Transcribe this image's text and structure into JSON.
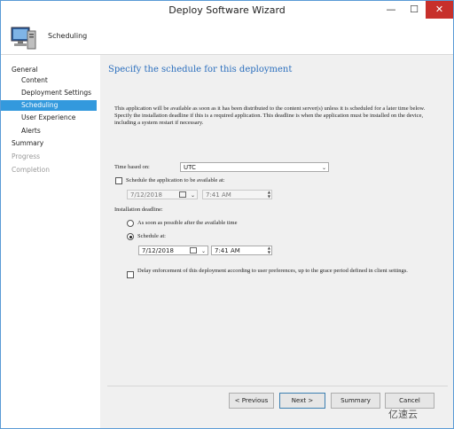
{
  "window": {
    "title": "Deploy Software Wizard",
    "minimize": "—",
    "maximize": "☐",
    "close": "✕"
  },
  "header": {
    "title": "Scheduling",
    "icon": "computer-icon"
  },
  "nav": {
    "items": [
      {
        "label": "General",
        "level": 0,
        "state": "normal"
      },
      {
        "label": "Content",
        "level": 1,
        "state": "normal"
      },
      {
        "label": "Deployment Settings",
        "level": 1,
        "state": "normal"
      },
      {
        "label": "Scheduling",
        "level": 1,
        "state": "selected"
      },
      {
        "label": "User Experience",
        "level": 1,
        "state": "normal"
      },
      {
        "label": "Alerts",
        "level": 1,
        "state": "normal"
      },
      {
        "label": "Summary",
        "level": 0,
        "state": "normal"
      },
      {
        "label": "Progress",
        "level": 0,
        "state": "disabled"
      },
      {
        "label": "Completion",
        "level": 0,
        "state": "disabled"
      }
    ]
  },
  "main": {
    "title": "Specify the schedule for this deployment",
    "description": "This application will be available as soon as it has been distributed to the content server(s) unless it is scheduled for a later time below. Specify the installation deadline if this is a required application. This deadline is when the application must be installed on the device, including a system restart if necessary.",
    "time_based_on": {
      "label": "Time based on:",
      "value": "UTC"
    },
    "schedule_available": {
      "label": "Schedule the application to be available at:",
      "checked": false,
      "date": "7/12/2018",
      "time": "7:41 AM"
    },
    "installation_deadline": {
      "label": "Installation deadline:",
      "asap_label": "As soon as possible after the available time",
      "schedule_label": "Schedule at:",
      "selected": "schedule",
      "date": "7/12/2018",
      "time": "7:41 AM"
    },
    "delay_enforcement": {
      "label": "Delay enforcement of this deployment according to user preferences, up to the grace period defined in client settings.",
      "checked": false
    }
  },
  "buttons": {
    "previous": "< Previous",
    "next": "Next >",
    "summary": "Summary",
    "cancel": "Cancel"
  },
  "watermark": "亿速云",
  "colors": {
    "accent": "#3399dd",
    "title_blue": "#2a6ebd",
    "close_red": "#c7302b"
  }
}
